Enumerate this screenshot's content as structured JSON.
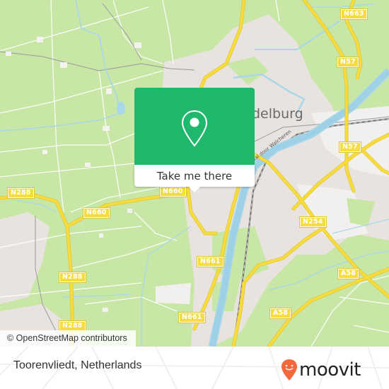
{
  "map": {
    "city_label": "Middelburg",
    "city_label_visible": "delburg",
    "canal_label": "Kanaal door Walcheren",
    "canal_label_visible": "aal door Walcheren",
    "road_shields": [
      {
        "label": "N663"
      },
      {
        "label": "N57"
      },
      {
        "label": "N57"
      },
      {
        "label": "N288"
      },
      {
        "label": "N660"
      },
      {
        "label": "N660"
      },
      {
        "label": "N254"
      },
      {
        "label": "N288"
      },
      {
        "label": "N661"
      },
      {
        "label": "A58"
      },
      {
        "label": "A58"
      },
      {
        "label": "N661"
      },
      {
        "label": "N288"
      }
    ],
    "colors": {
      "land": "#c8e6a6",
      "urban": "#e9e3e0",
      "water": "#a9d7ea",
      "road_major": "#f6dc3f",
      "road_minor": "#ffffff"
    }
  },
  "popup": {
    "icon": "map-pin-icon",
    "button_label": "Take me there",
    "accent_color": "#1fb86c"
  },
  "attribution": "© OpenStreetMap contributors",
  "footer": {
    "place_name": "Toorenvliedt, Netherlands",
    "logo_text": "moovit",
    "logo_icon": "moovit-pin-icon",
    "logo_color": "#f4683c"
  }
}
